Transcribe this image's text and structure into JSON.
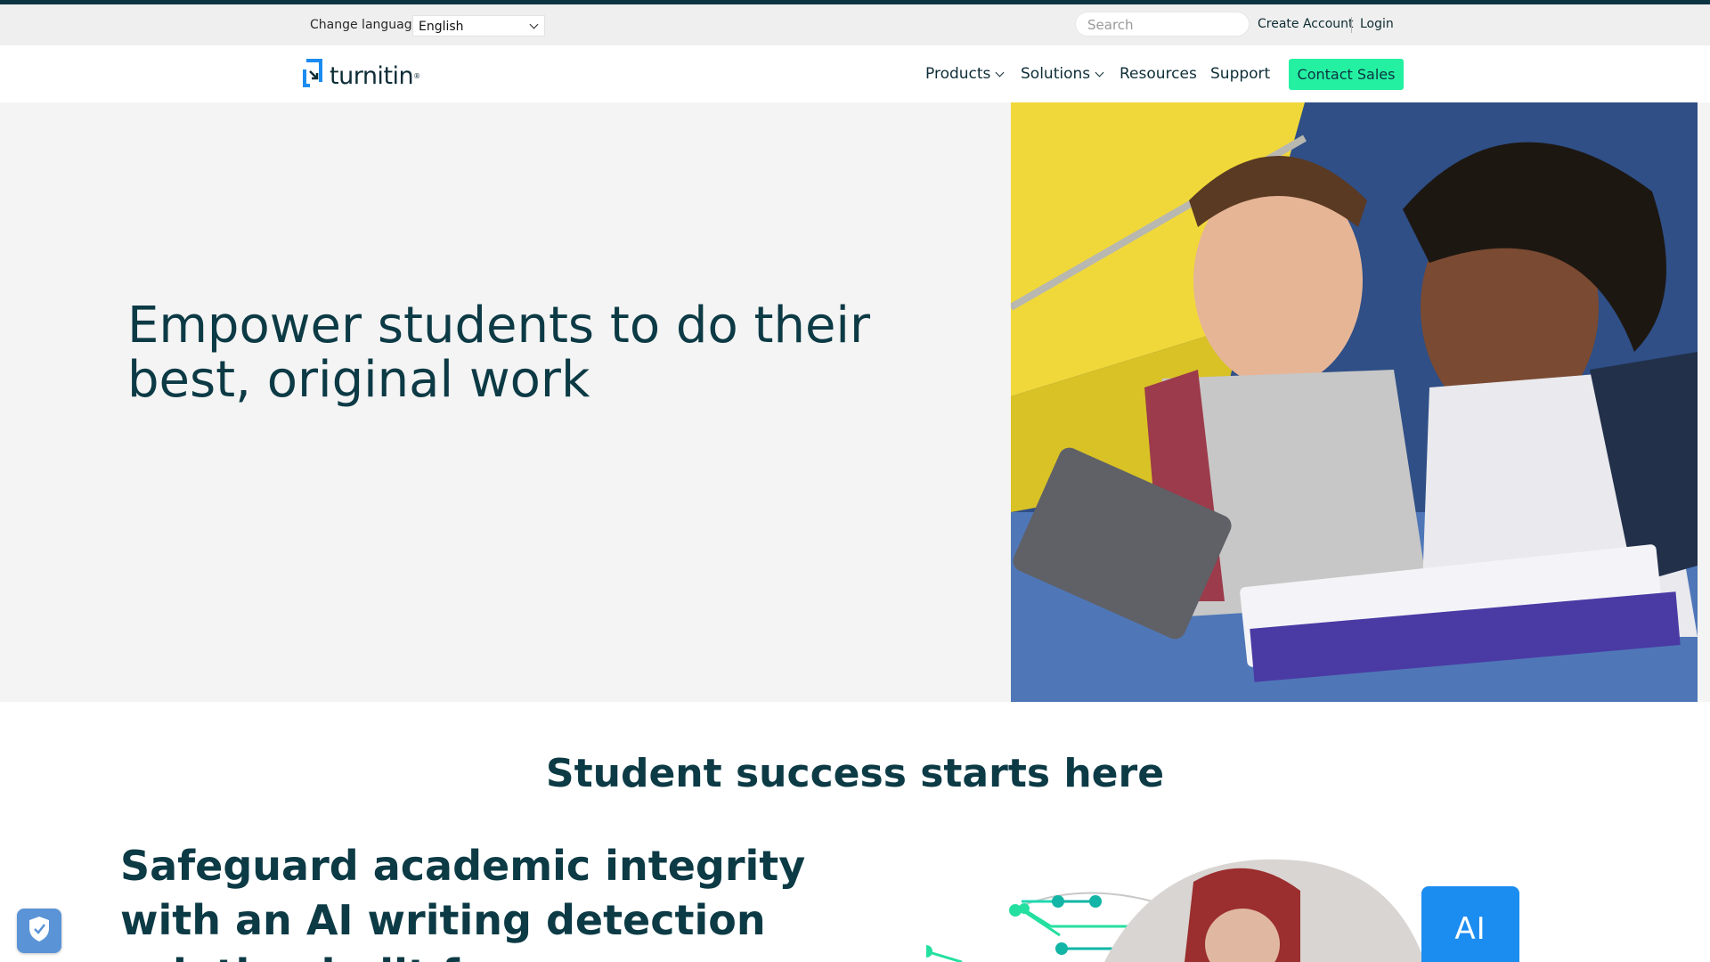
{
  "utility_bar": {
    "language_label": "Change language",
    "language_selected": "English",
    "search_placeholder": "Search",
    "create_account": "Create Account",
    "login": "Login"
  },
  "nav": {
    "logo_text": "turnitin",
    "items": [
      {
        "label": "Products"
      },
      {
        "label": "Solutions"
      },
      {
        "label": "Resources"
      },
      {
        "label": "Support"
      }
    ],
    "cta": "Contact Sales"
  },
  "hero": {
    "title": "Empower students to do their best, original work"
  },
  "section": {
    "title": "Student success starts here",
    "subtitle": "Safeguard academic integrity with an AI writing detection solution built for",
    "ai_badge": "AI"
  },
  "colors": {
    "brand_dark": "#0c3a45",
    "accent_green": "#24f0a2",
    "ai_blue": "#1b8cf0",
    "utility_bg": "#efefef",
    "hero_bg": "#f4f4f4"
  }
}
